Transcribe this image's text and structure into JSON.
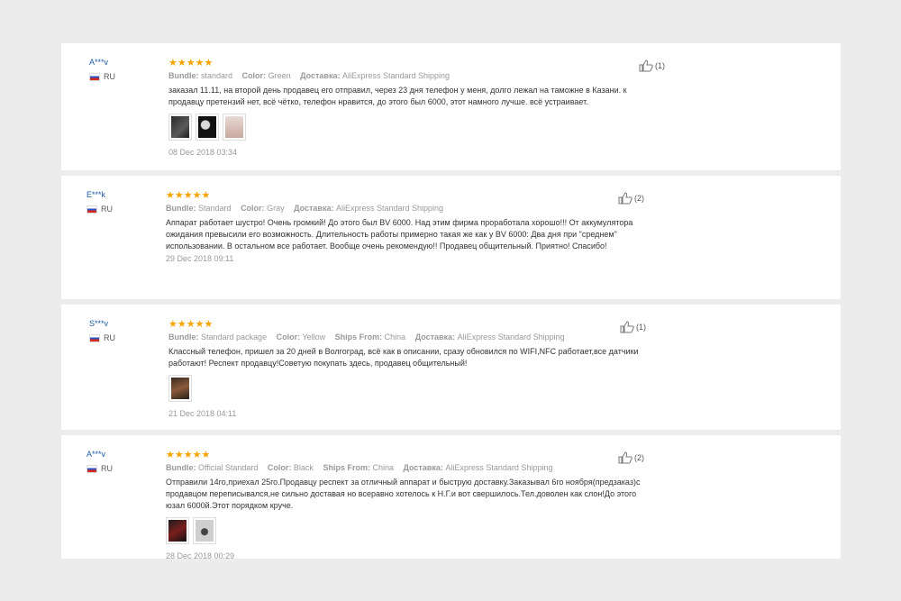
{
  "reviews": [
    {
      "user": "A***v",
      "country": "RU",
      "stars": "★★★★★",
      "meta": [
        {
          "k": "Bundle:",
          "v": "standard"
        },
        {
          "k": "Color:",
          "v": "Green"
        },
        {
          "k": "Доставка:",
          "v": "AliExpress Standard Shipping"
        }
      ],
      "text": "заказал 11.11, на второй день продавец его отправил, через 23 дня телефон у меня, долго лежал на таможне в Казани. к продавцу претензий нет, всё чётко, телефон нравится, до этого был 6000, этот намного лучше. всё устраивает.",
      "photos": [
        "phone-photo",
        "phone-photo",
        "phone-photo"
      ],
      "date": "08 Dec 2018 03:34",
      "likes": "(1)"
    },
    {
      "user": "E***k",
      "country": "RU",
      "stars": "★★★★★",
      "meta": [
        {
          "k": "Bundle:",
          "v": "Standard"
        },
        {
          "k": "Color:",
          "v": "Gray"
        },
        {
          "k": "Доставка:",
          "v": "AliExpress Standard Shipping"
        }
      ],
      "text": "Аппарат работает шустро! Очень громкий! До этого был BV 6000. Над этим фирма проработала хорошо!!! От аккумулятора ожидания превысили его возможность. Длительность работы примерно такая же как у BV 6000: Два дня при \"среднем\" использовании. В остальном все работает. Вообще очень рекомендую!! Продавец общительный. Приятно! Спасибо!",
      "photos": [],
      "date": "29 Dec 2018 09:11",
      "likes": "(2)"
    },
    {
      "user": "S***v",
      "country": "RU",
      "stars": "★★★★★",
      "meta": [
        {
          "k": "Bundle:",
          "v": "Standard package"
        },
        {
          "k": "Color:",
          "v": "Yellow"
        },
        {
          "k": "Ships From:",
          "v": "China"
        },
        {
          "k": "Доставка:",
          "v": "AliExpress Standard Shipping"
        }
      ],
      "text": "Классный телефон, пришел за 20 дней в Волгоград, всё как в описании, сразу обновился по WIFI,NFC работает,все датчики работают! Респект продавцу!Советую покупать здесь, продавец общительный!",
      "photos": [
        "phone-photo"
      ],
      "date": "21 Dec 2018 04:11",
      "likes": "(1)"
    },
    {
      "user": "A***v",
      "country": "RU",
      "stars": "★★★★★",
      "meta": [
        {
          "k": "Bundle:",
          "v": "Official Standard"
        },
        {
          "k": "Color:",
          "v": "Black"
        },
        {
          "k": "Ships From:",
          "v": "China"
        },
        {
          "k": "Доставка:",
          "v": "AliExpress Standard Shipping"
        }
      ],
      "text": "Отправили 14го,приехал 25го.Продавцу респект за отличный аппарат и быструю доставку.Заказывал 6го ноября(предзаказ)с продавцом переписывался,не сильно доставая но всеравно хотелось к Н.Г.и вот свершилось.Тел.доволен как слон!До этого юзал 6000й.Этот порядком круче.",
      "photos": [
        "phone-photo",
        "phone-photo"
      ],
      "date": "28 Dec 2018 00:29",
      "likes": "(2)"
    }
  ]
}
